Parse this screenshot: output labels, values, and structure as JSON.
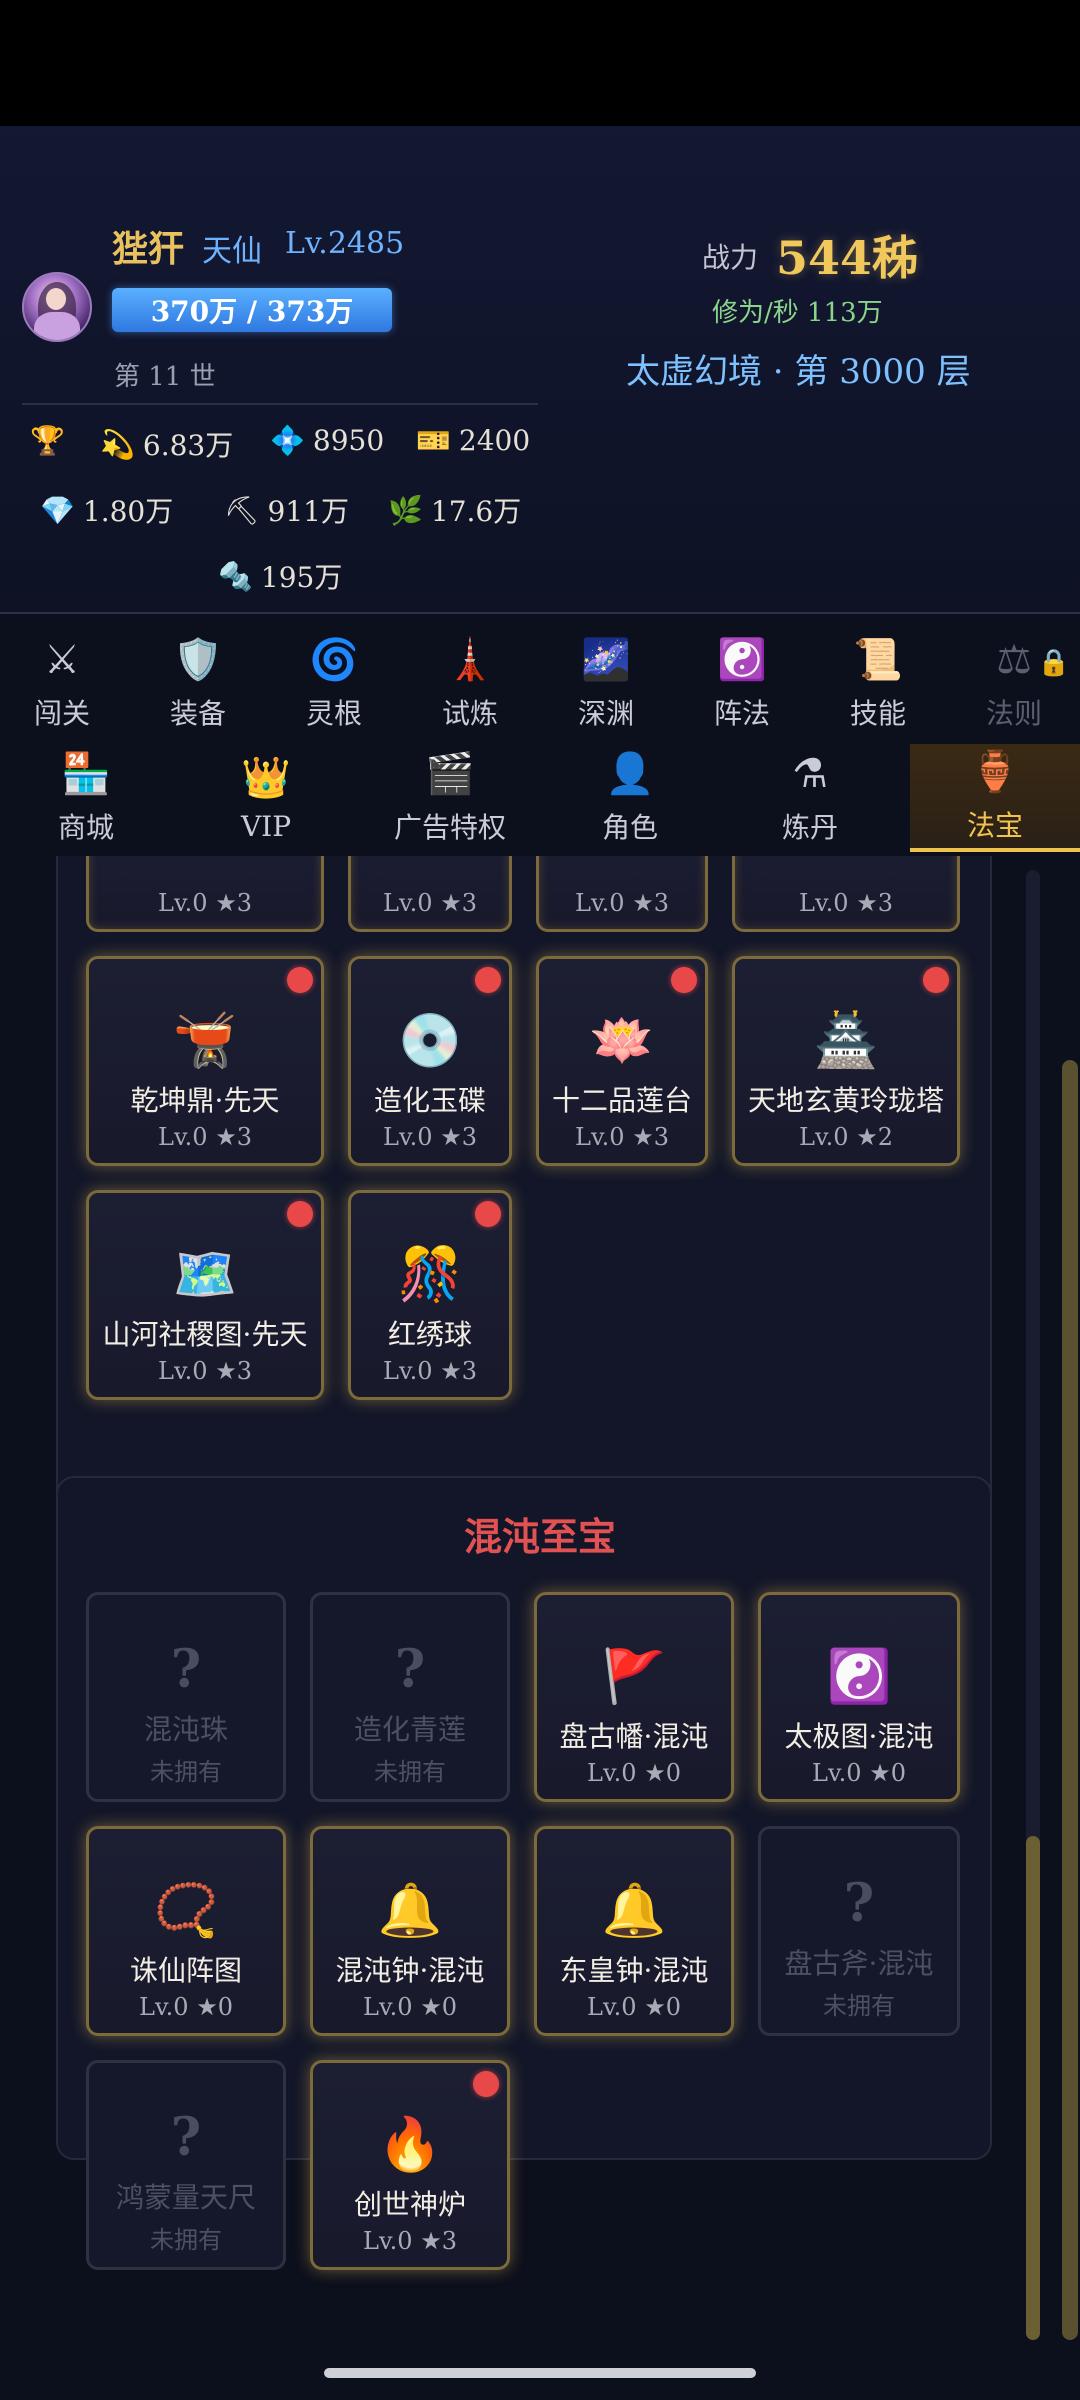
{
  "player": {
    "name": "狴犴",
    "realm": "天仙",
    "level": "Lv.2485",
    "hp": "370万 / 373万",
    "generation": "第 11 世",
    "power_label": "战力",
    "power_value": "544秭",
    "rate": "修为/秒 113万",
    "location": "太虚幻境 · 第 3000 层"
  },
  "resources": [
    {
      "icon": "trophy-icon",
      "glyph": "🏆",
      "value": ""
    },
    {
      "icon": "comet-icon",
      "glyph": "💫",
      "value": "6.83万"
    },
    {
      "icon": "crystal-icon",
      "glyph": "💠",
      "value": "8950"
    },
    {
      "icon": "ticket-icon",
      "glyph": "🎫",
      "value": "2400"
    },
    {
      "icon": "diamond-icon",
      "glyph": "💎",
      "value": "1.80万"
    },
    {
      "icon": "pickaxe-icon",
      "glyph": "⛏",
      "value": "911万"
    },
    {
      "icon": "herb-icon",
      "glyph": "🌿",
      "value": "17.6万"
    },
    {
      "icon": "bolt-icon",
      "glyph": "🔩",
      "value": "195万"
    }
  ],
  "nav_row1": [
    {
      "label": "闯关",
      "glyph": "⚔"
    },
    {
      "label": "装备",
      "glyph": "🛡️"
    },
    {
      "label": "灵根",
      "glyph": "🌀"
    },
    {
      "label": "试炼",
      "glyph": "🗼"
    },
    {
      "label": "深渊",
      "glyph": "🌌"
    },
    {
      "label": "阵法",
      "glyph": "☯️"
    },
    {
      "label": "技能",
      "glyph": "📜"
    },
    {
      "label": "法则",
      "glyph": "⚖"
    }
  ],
  "nav_row2": [
    {
      "label": "商城",
      "glyph": "🏪"
    },
    {
      "label": "VIP",
      "glyph": "👑"
    },
    {
      "label": "广告特权",
      "glyph": "🎬"
    },
    {
      "label": "角色",
      "glyph": "👤"
    },
    {
      "label": "炼丹",
      "glyph": "⚗"
    },
    {
      "label": "法宝",
      "glyph": "🏺"
    }
  ],
  "top_partial": [
    {
      "level": "Lv.0 ★3"
    },
    {
      "level": "Lv.0 ★3"
    },
    {
      "level": "Lv.0 ★3"
    },
    {
      "level": "Lv.0 ★3"
    }
  ],
  "treasures_top": [
    {
      "name": "乾坤鼎·先天",
      "level": "Lv.0 ★3",
      "glyph": "🫕"
    },
    {
      "name": "造化玉碟",
      "level": "Lv.0 ★3",
      "glyph": "💿"
    },
    {
      "name": "十二品莲台",
      "level": "Lv.0 ★3",
      "glyph": "🪷"
    },
    {
      "name": "天地玄黄玲珑塔",
      "level": "Lv.0 ★2",
      "glyph": "🏯"
    },
    {
      "name": "山河社稷图·先天",
      "level": "Lv.0 ★3",
      "glyph": "🗺️"
    },
    {
      "name": "红绣球",
      "level": "Lv.0 ★3",
      "glyph": "🎊"
    }
  ],
  "chaos_section": {
    "title": "混沌至宝",
    "items": [
      {
        "name": "混沌珠",
        "level": "未拥有",
        "glyph": "?",
        "owned": false
      },
      {
        "name": "造化青莲",
        "level": "未拥有",
        "glyph": "?",
        "owned": false
      },
      {
        "name": "盘古幡·混沌",
        "level": "Lv.0 ★0",
        "glyph": "🚩",
        "owned": true
      },
      {
        "name": "太极图·混沌",
        "level": "Lv.0 ★0",
        "glyph": "☯️",
        "owned": true
      },
      {
        "name": "诛仙阵图",
        "level": "Lv.0 ★0",
        "glyph": "📿",
        "owned": true
      },
      {
        "name": "混沌钟·混沌",
        "level": "Lv.0 ★0",
        "glyph": "🔔",
        "owned": true
      },
      {
        "name": "东皇钟·混沌",
        "level": "Lv.0 ★0",
        "glyph": "🔔",
        "owned": true
      },
      {
        "name": "盘古斧·混沌",
        "level": "未拥有",
        "glyph": "?",
        "owned": false
      },
      {
        "name": "鸿蒙量天尺",
        "level": "未拥有",
        "glyph": "?",
        "owned": false
      },
      {
        "name": "创世神炉",
        "level": "Lv.0 ★3",
        "glyph": "🔥",
        "owned": true
      }
    ]
  }
}
